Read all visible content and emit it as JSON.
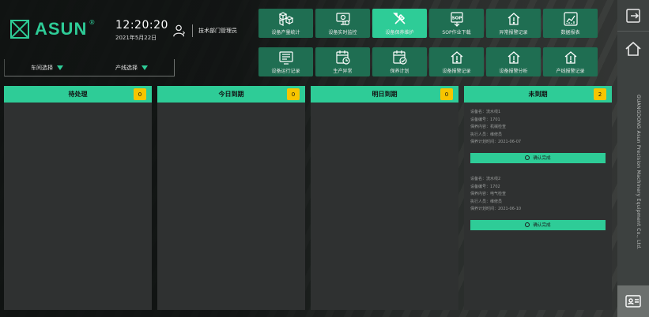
{
  "brand": {
    "name": "ASUN",
    "reg_mark": "®"
  },
  "clock": {
    "time": "12:20:20",
    "date": "2021年5月22日"
  },
  "user": {
    "name": "技术部门管理员"
  },
  "filters": [
    {
      "label": "车间选择"
    },
    {
      "label": "产线选择"
    }
  ],
  "nav": [
    {
      "label": "设备产量统计",
      "icon": "boxes-icon"
    },
    {
      "label": "设备实时监控",
      "icon": "monitor-icon"
    },
    {
      "label": "设备保养维护",
      "icon": "tools-icon"
    },
    {
      "label": "SOP作业下载",
      "icon": "sop-icon"
    },
    {
      "label": "异常报警记录",
      "icon": "alarm-house-icon"
    },
    {
      "label": "数据报表",
      "icon": "chart-icon"
    },
    {
      "label": "设备运行记录",
      "icon": "log-icon"
    },
    {
      "label": "生产异常",
      "icon": "calendar-icon"
    },
    {
      "label": "保养计划",
      "icon": "calendar-check-icon"
    },
    {
      "label": "设备报警记录",
      "icon": "alarm-icon"
    },
    {
      "label": "设备报警分析",
      "icon": "alarm-analysis-icon"
    },
    {
      "label": "产线报警记录",
      "icon": "line-alarm-icon"
    }
  ],
  "columns": [
    {
      "title": "待处理",
      "count": "0"
    },
    {
      "title": "今日到期",
      "count": "0"
    },
    {
      "title": "明日到期",
      "count": "0"
    },
    {
      "title": "未到期",
      "count": "2"
    }
  ],
  "cards": [
    {
      "lines": [
        "设备名：流水线1",
        "设备编号：1701",
        "保养内容：机械检查",
        "执行人员：维修员",
        "保养计划时间：2021-06-07"
      ],
      "button": "确认完成"
    },
    {
      "lines": [
        "设备名：流水线2",
        "设备编号：1702",
        "保养内容：电气检查",
        "执行人员：维修员",
        "保养计划时间：2021-06-10"
      ],
      "button": "确认完成"
    }
  ],
  "company": "GUANGDONG Asun Precision Machinery Equipment Co., Ltd.",
  "colors": {
    "accent": "#2ecc97",
    "nav_inactive": "#1f6e52",
    "badge": "#f7c500",
    "panel": "#2f3131"
  }
}
